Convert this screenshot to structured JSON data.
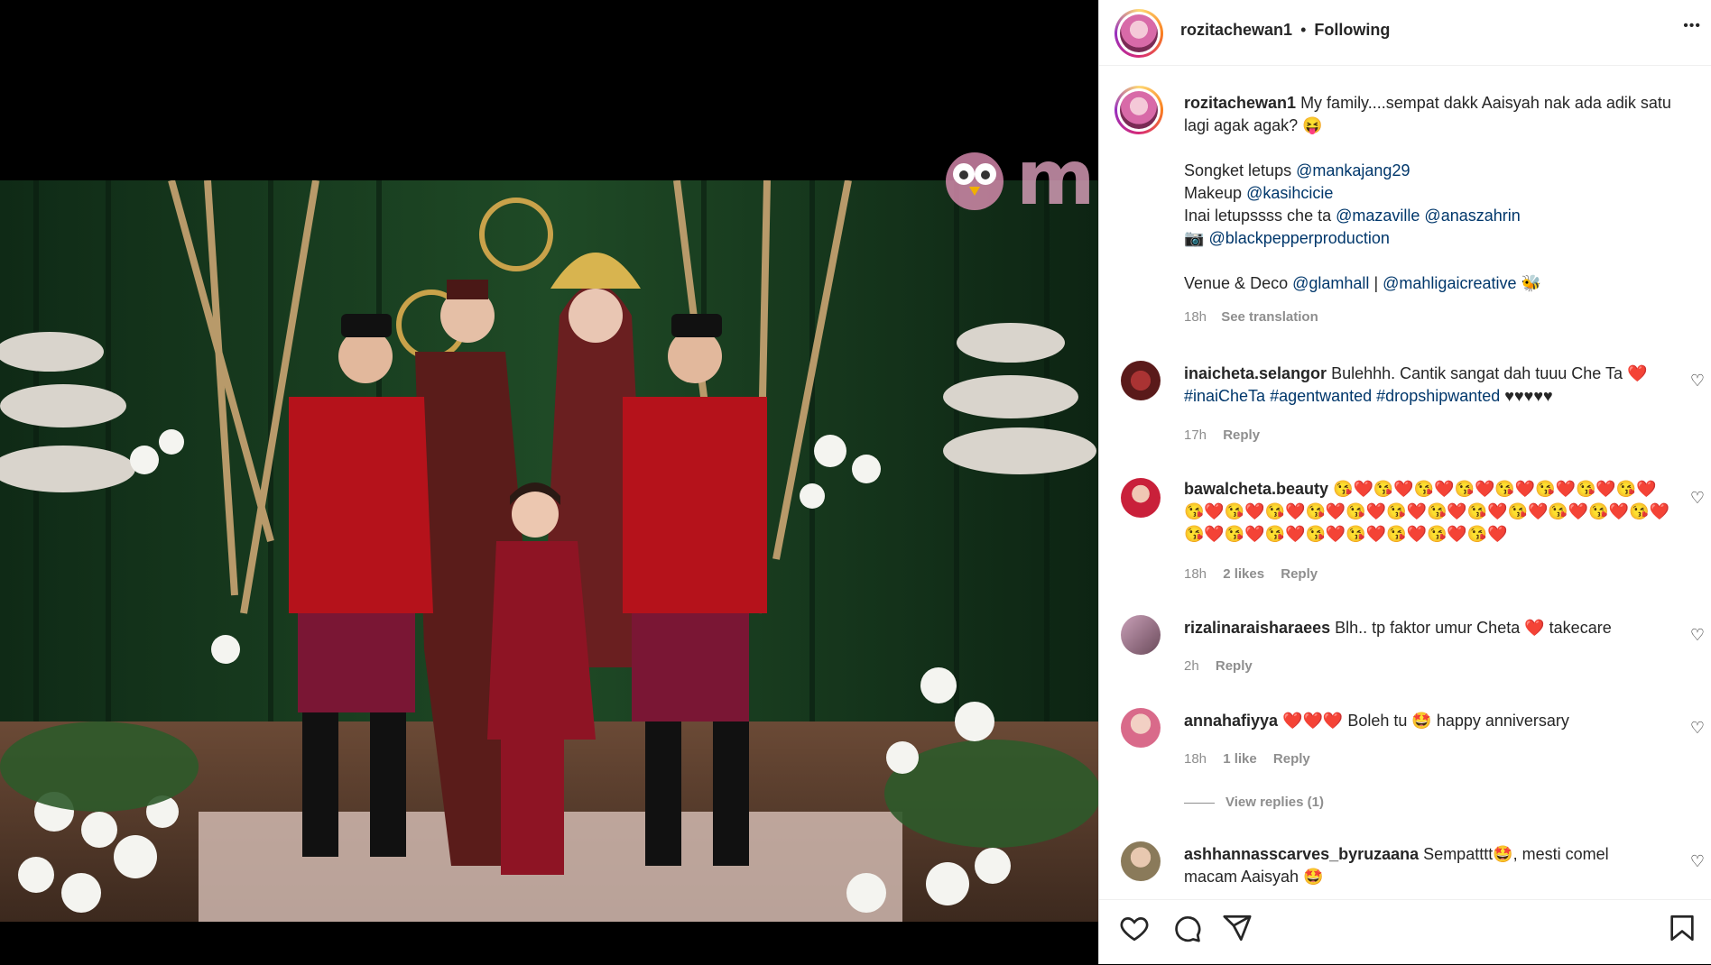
{
  "watermark": "murai",
  "post_header": {
    "username": "rozitachewan1",
    "separator": "•",
    "follow_status": "Following",
    "more_label": "•••"
  },
  "caption": {
    "username": "rozitachewan1",
    "text": "My family....sempat dakk Aaisyah nak ada adik satu lagi agak agak?",
    "emoji": "😝",
    "lines": [
      {
        "prefix": "Songket letups",
        "mentions": [
          "@mankajang29"
        ]
      },
      {
        "prefix": "Makeup",
        "mentions": [
          "@kasihcicie"
        ]
      },
      {
        "prefix": "Inai letupssss che ta",
        "mentions": [
          "@mazaville",
          "@anaszahrin"
        ]
      },
      {
        "prefix": "📷",
        "mentions": [
          "@blackpepperproduction"
        ]
      }
    ],
    "venue_prefix": "Venue & Deco",
    "venue_mention_1": "@glamhall",
    "venue_sep": "|",
    "venue_mention_2": "@mahligaicreative",
    "venue_emoji": "🐝",
    "time": "18h",
    "see_translation": "See translation"
  },
  "comments": [
    {
      "username": "inaicheta.selangor",
      "text": "Bulehhh. Cantik sangat dah tuuu Che Ta",
      "emoji_after": "❤️",
      "line2_tags": "#inaiCheTa #agentwanted #dropshipwanted",
      "line2_tail": "♥♥♥♥♥",
      "time": "17h",
      "reply": "Reply"
    },
    {
      "username": "bawalcheta.beauty",
      "emoji_row": "😘❤️😘❤️😘❤️😘❤️😘❤️😘❤️😘❤️😘❤️😘❤️😘❤️😘❤️😘❤️😘❤️😘❤️😘❤️😘❤️😘❤️😘❤️😘❤️😘❤️😘❤️😘❤️😘❤️😘❤️😘❤️😘❤️😘❤️😘❤️",
      "time": "18h",
      "likes": "2 likes",
      "reply": "Reply"
    },
    {
      "username": "rizalinaraisharaees",
      "text": "Blh.. tp faktor umur Cheta",
      "emoji_after": "❤️",
      "tail": "takecare",
      "time": "2h",
      "reply": "Reply"
    },
    {
      "username": "annahafiyya",
      "emoji_before": "❤️❤️❤️",
      "text": "Boleh tu",
      "emoji_mid": "🤩",
      "tail": "happy anniversary",
      "time": "18h",
      "likes": "1 like",
      "reply": "Reply",
      "view_replies": "View replies (1)"
    },
    {
      "username": "ashhannasscarves_byruzaana",
      "text": "Sempatttt",
      "emoji_mid": "🤩",
      "tail": ", mesti comel",
      "line2": "macam Aaisyah",
      "emoji_end": "🤩"
    }
  ],
  "colors": {
    "link": "#00376b",
    "meta": "#8e8e8e",
    "heart_red": "#ed4956"
  }
}
